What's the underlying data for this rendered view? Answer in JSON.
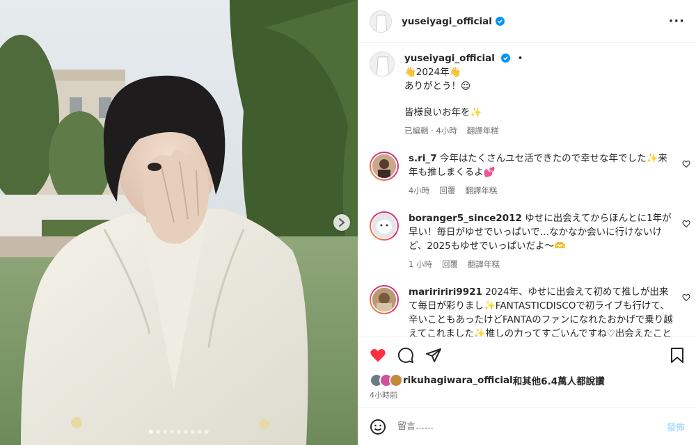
{
  "post": {
    "username": "yuseiyagi_official",
    "more_icon": "more-horizontal-icon",
    "caption": {
      "dot": "•",
      "line1": "👋2024年👋",
      "line2": "ありがとう！☺",
      "line3": "皆様良いお年を✨",
      "edited": "已編輯",
      "time": "4小時",
      "translate": "翻譯年糕"
    }
  },
  "comments": [
    {
      "username": "s.ri_7",
      "text": "今年はたくさんユセ活できたので幸せな年でした✨来年も推しまくるよ💕",
      "time": "4小時",
      "reply": "回覆",
      "translate": "翻譯年糕"
    },
    {
      "username": "boranger5_since2012",
      "text": "ゆせに出会えてからほんとに1年が早い！毎日がゆせでいっぱいで…なかなか会いに行けないけど、2025もゆせでいっぱいだよ〜🫶",
      "time": "1 小時",
      "reply": "回覆",
      "translate": "翻譯年糕"
    },
    {
      "username": "mariririri9921",
      "text": "2024年、ゆせに出会えて初めて推しが出来て毎日が彩りまし✨FANTASTICDISCOで初ライブも行けて、辛いこともあったけどFANTAのファンになれたおかげで乗り越えてこれました✨推しの力ってすごいんですね♡出会えたことに"
    }
  ],
  "likes": {
    "liker": "rikuhagiwara_official",
    "rest": "和其他6.4萬人都說讚"
  },
  "posted": "4小時前",
  "comment_box": {
    "placeholder": "留言……",
    "post_label": "發佈"
  },
  "carousel": {
    "total": 9,
    "current": 1
  },
  "colors": {
    "verified": "#0095f6",
    "liked": "#ff3040",
    "post_disabled": "#b2dffc"
  }
}
